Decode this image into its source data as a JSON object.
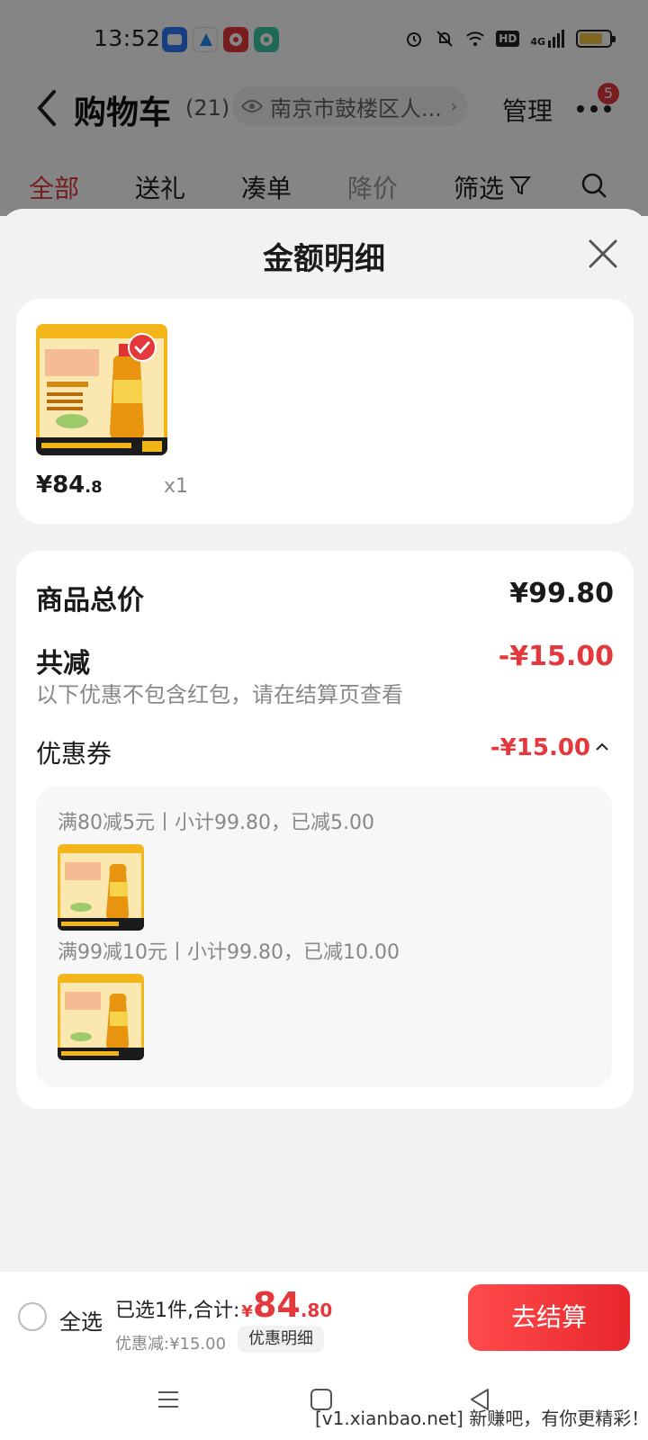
{
  "status_bar": {
    "time": "13:52",
    "icons": [
      "message-app-icon",
      "browser-app-icon",
      "jd-app-icon",
      "chat-app-icon",
      "alarm-icon",
      "mute-icon",
      "wifi-icon",
      "hd-icon",
      "signal-icon",
      "battery-icon"
    ],
    "hd_label": "HD",
    "network_label": "4G",
    "battery_level": 0.78
  },
  "header": {
    "title": "购物车",
    "count": "(21)",
    "location": "南京市鼓楼区人...",
    "manage_label": "管理",
    "badge_count": "5"
  },
  "filter_tabs": [
    {
      "label": "全部",
      "state": "active"
    },
    {
      "label": "送礼",
      "state": "normal"
    },
    {
      "label": "凑单",
      "state": "normal"
    },
    {
      "label": "降价",
      "state": "muted"
    },
    {
      "label": "筛选",
      "state": "normal"
    }
  ],
  "sheet": {
    "title": "金额明细",
    "item": {
      "price_main": "¥84",
      "price_decimal": ".8",
      "quantity": "x1"
    },
    "summary": {
      "total_label": "商品总价",
      "total_value": "¥99.80",
      "discount_label": "共减",
      "discount_value": "-¥15.00",
      "note": "以下优惠不包含红包，请在结算页查看",
      "coupon_label": "优惠券",
      "coupon_value": "-¥15.00"
    },
    "promotions": [
      {
        "text": "满80减5元丨小计99.80，已减5.00"
      },
      {
        "text": "满99减10元丨小计99.80，已减10.00"
      }
    ]
  },
  "checkout": {
    "select_all_label": "全选",
    "selected_text": "已选1件,合计:",
    "currency": "¥",
    "total_integer": "84",
    "total_decimal": ".80",
    "discount_text": "优惠减:¥15.00",
    "detail_label": "优惠明细",
    "checkout_label": "去结算"
  },
  "watermark": "[v1.xianbao.net] 新赚吧，有你更精彩！",
  "colors": {
    "accent_red": "#e4393c",
    "dim_overlay": "rgba(0,0,0,0.48)",
    "product_yellow": "#f2b61a"
  }
}
